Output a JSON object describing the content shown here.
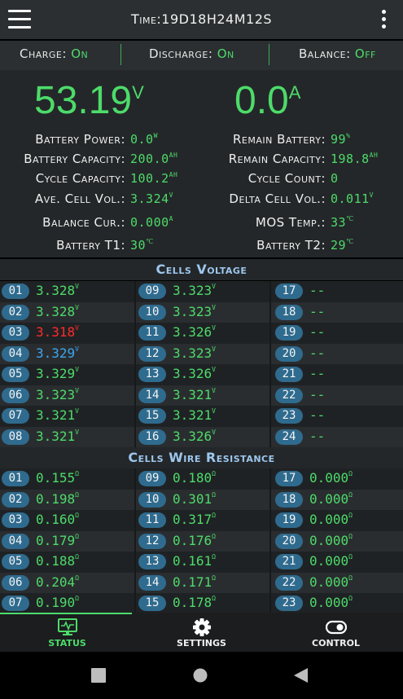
{
  "header": {
    "time_label": "Time:",
    "time_value": "19D18H24M12S"
  },
  "switches": {
    "charge_label": "Charge:",
    "charge_value": "On",
    "discharge_label": "Discharge:",
    "discharge_value": "On",
    "balance_label": "Balance:",
    "balance_value": "Off"
  },
  "main": {
    "voltage_value": "53.19",
    "voltage_unit": "V",
    "current_value": "0.0",
    "current_unit": "A"
  },
  "stats_left": [
    {
      "label": "Battery Power:",
      "value": "0.0",
      "unit": "W"
    },
    {
      "label": "Battery Capacity:",
      "value": "200.0",
      "unit": "AH"
    },
    {
      "label": "Cycle Capacity:",
      "value": "100.2",
      "unit": "AH"
    },
    {
      "label": "Ave. Cell Vol.:",
      "value": "3.324",
      "unit": "V"
    },
    {
      "label": "Balance Cur.:",
      "value": "0.000",
      "unit": "A"
    },
    {
      "label": "Battery T1:",
      "value": "30",
      "unit": "℃"
    }
  ],
  "stats_right": [
    {
      "label": "Remain Battery:",
      "value": "99",
      "unit": "%"
    },
    {
      "label": "Remain Capacity:",
      "value": "198.8",
      "unit": "AH"
    },
    {
      "label": "Cycle Count:",
      "value": "0",
      "unit": ""
    },
    {
      "label": "Delta Cell Vol.:",
      "value": "0.011",
      "unit": "V"
    },
    {
      "label": "MOS Temp.:",
      "value": "33",
      "unit": "℃"
    },
    {
      "label": "Battery T2:",
      "value": "29",
      "unit": "℃"
    }
  ],
  "cells_voltage": {
    "title": "Cells Voltage",
    "unit": "V",
    "cells": [
      {
        "id": "01",
        "value": "3.328",
        "state": "normal"
      },
      {
        "id": "02",
        "value": "3.328",
        "state": "normal"
      },
      {
        "id": "03",
        "value": "3.318",
        "state": "min"
      },
      {
        "id": "04",
        "value": "3.329",
        "state": "max"
      },
      {
        "id": "05",
        "value": "3.329",
        "state": "normal"
      },
      {
        "id": "06",
        "value": "3.323",
        "state": "normal"
      },
      {
        "id": "07",
        "value": "3.321",
        "state": "normal"
      },
      {
        "id": "08",
        "value": "3.321",
        "state": "normal"
      },
      {
        "id": "09",
        "value": "3.323",
        "state": "normal"
      },
      {
        "id": "10",
        "value": "3.323",
        "state": "normal"
      },
      {
        "id": "11",
        "value": "3.326",
        "state": "normal"
      },
      {
        "id": "12",
        "value": "3.323",
        "state": "normal"
      },
      {
        "id": "13",
        "value": "3.326",
        "state": "normal"
      },
      {
        "id": "14",
        "value": "3.321",
        "state": "normal"
      },
      {
        "id": "15",
        "value": "3.321",
        "state": "normal"
      },
      {
        "id": "16",
        "value": "3.326",
        "state": "normal"
      },
      {
        "id": "17",
        "value": "--",
        "state": "empty"
      },
      {
        "id": "18",
        "value": "--",
        "state": "empty"
      },
      {
        "id": "19",
        "value": "--",
        "state": "empty"
      },
      {
        "id": "20",
        "value": "--",
        "state": "empty"
      },
      {
        "id": "21",
        "value": "--",
        "state": "empty"
      },
      {
        "id": "22",
        "value": "--",
        "state": "empty"
      },
      {
        "id": "23",
        "value": "--",
        "state": "empty"
      },
      {
        "id": "24",
        "value": "--",
        "state": "empty"
      }
    ]
  },
  "cells_resistance": {
    "title": "Cells Wire Resistance",
    "unit": "Ω",
    "cells": [
      {
        "id": "01",
        "value": "0.155"
      },
      {
        "id": "02",
        "value": "0.198"
      },
      {
        "id": "03",
        "value": "0.160"
      },
      {
        "id": "04",
        "value": "0.179"
      },
      {
        "id": "05",
        "value": "0.188"
      },
      {
        "id": "06",
        "value": "0.204"
      },
      {
        "id": "07",
        "value": "0.190"
      },
      {
        "id": "09",
        "value": "0.180"
      },
      {
        "id": "10",
        "value": "0.301"
      },
      {
        "id": "11",
        "value": "0.317"
      },
      {
        "id": "12",
        "value": "0.176"
      },
      {
        "id": "13",
        "value": "0.161"
      },
      {
        "id": "14",
        "value": "0.171"
      },
      {
        "id": "15",
        "value": "0.178"
      },
      {
        "id": "17",
        "value": "0.000"
      },
      {
        "id": "18",
        "value": "0.000"
      },
      {
        "id": "19",
        "value": "0.000"
      },
      {
        "id": "20",
        "value": "0.000"
      },
      {
        "id": "21",
        "value": "0.000"
      },
      {
        "id": "22",
        "value": "0.000"
      },
      {
        "id": "23",
        "value": "0.000"
      }
    ]
  },
  "nav": {
    "status_label": "STATUS",
    "settings_label": "SETTINGS",
    "control_label": "CONTROL",
    "active": "status"
  },
  "colors": {
    "accent_green": "#4ddb6a",
    "min_cell_red": "#ff2a2a",
    "max_cell_blue": "#3aa7f0",
    "badge_blue": "#2f6b8e",
    "section_title_blue": "#9dc7ee"
  },
  "icons": {
    "menu": "hamburger-menu-icon",
    "more": "more-vertical-icon",
    "status": "monitor-pulse-icon",
    "settings": "gear-icon",
    "control": "toggle-switch-icon",
    "recent_apps": "square-icon",
    "home": "circle-icon",
    "back": "triangle-back-icon"
  }
}
